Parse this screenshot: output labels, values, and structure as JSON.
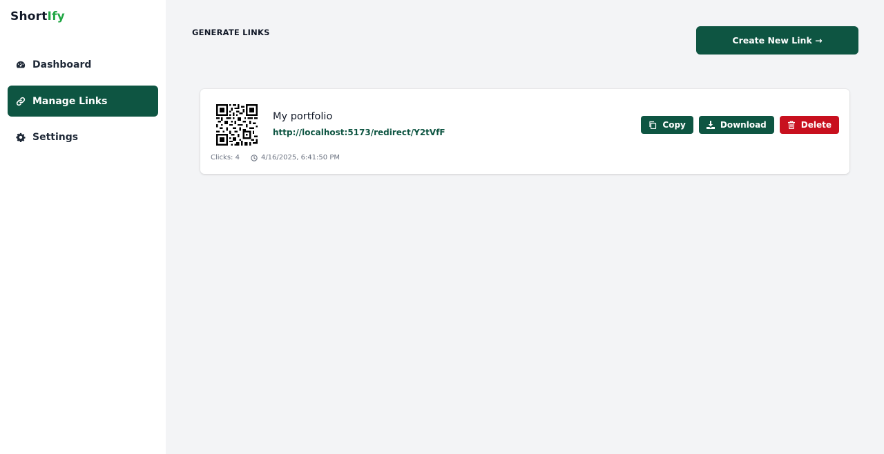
{
  "brand": {
    "part1": "Short",
    "part2": "Ify"
  },
  "sidebar": {
    "items": [
      {
        "label": "Dashboard",
        "icon": "gauge-icon"
      },
      {
        "label": "Manage Links",
        "icon": "link-icon"
      },
      {
        "label": "Settings",
        "icon": "gear-icon"
      }
    ]
  },
  "header": {
    "title": "GENERATE LINKS",
    "create_label": "Create New Link →"
  },
  "links": [
    {
      "title": "My portfolio",
      "url": "http://localhost:5173/redirect/Y2tVfF",
      "clicks": "Clicks: 4",
      "created": "4/16/2025, 6:41:50 PM",
      "actions": {
        "copy": "Copy",
        "download": "Download",
        "delete": "Delete"
      }
    }
  ],
  "colors": {
    "accent": "#0e5542",
    "brand_green": "#22a745",
    "danger": "#c8101e",
    "background": "#f3f4f6"
  }
}
